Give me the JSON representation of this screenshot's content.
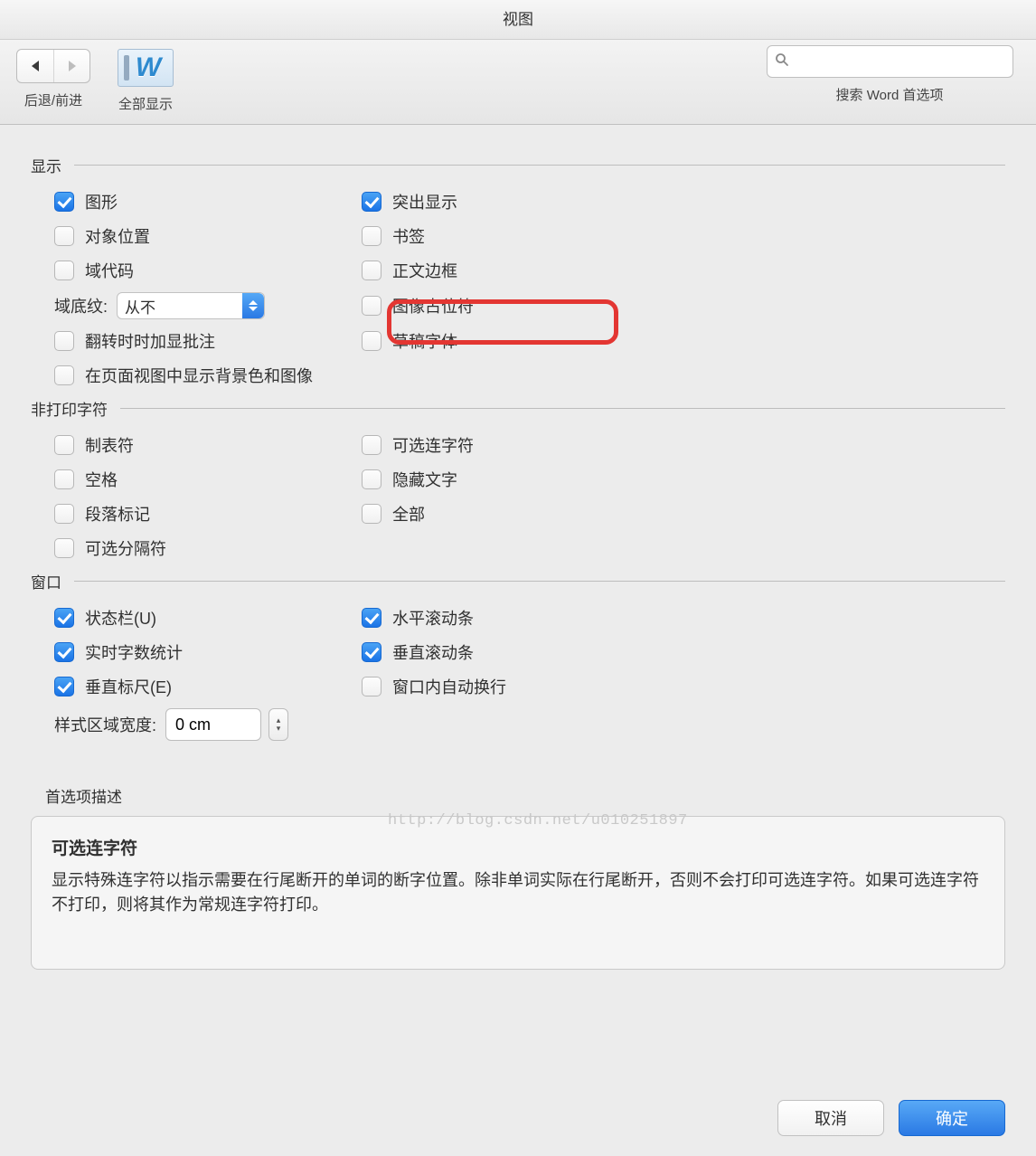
{
  "window": {
    "title": "视图"
  },
  "toolbar": {
    "nav_label": "后退/前进",
    "show_all_label": "全部显示",
    "search_label": "搜索 Word 首选项",
    "search_placeholder": ""
  },
  "sections": {
    "display": {
      "title": "显示",
      "left": [
        {
          "label": "图形",
          "checked": true
        },
        {
          "label": "对象位置",
          "checked": false
        },
        {
          "label": "域代码",
          "checked": false
        }
      ],
      "field_shading_label": "域底纹:",
      "field_shading_value": "从不",
      "left2": [
        {
          "label": "翻转时时加显批注",
          "checked": false
        },
        {
          "label": "在页面视图中显示背景色和图像",
          "checked": false
        }
      ],
      "right": [
        {
          "label": "突出显示",
          "checked": true
        },
        {
          "label": "书签",
          "checked": false
        },
        {
          "label": "正文边框",
          "checked": false
        },
        {
          "label": "图像占位符",
          "checked": false
        },
        {
          "label": "草稿字体",
          "checked": false
        }
      ]
    },
    "nonprint": {
      "title": "非打印字符",
      "left": [
        {
          "label": "制表符",
          "checked": false
        },
        {
          "label": "空格",
          "checked": false
        },
        {
          "label": "段落标记",
          "checked": false
        },
        {
          "label": "可选分隔符",
          "checked": false
        }
      ],
      "right": [
        {
          "label": "可选连字符",
          "checked": false
        },
        {
          "label": "隐藏文字",
          "checked": false
        },
        {
          "label": "全部",
          "checked": false
        }
      ]
    },
    "window": {
      "title": "窗口",
      "left": [
        {
          "label": "状态栏(U)",
          "checked": true
        },
        {
          "label": "实时字数统计",
          "checked": true
        },
        {
          "label": "垂直标尺(E)",
          "checked": true
        }
      ],
      "right": [
        {
          "label": "水平滚动条",
          "checked": true
        },
        {
          "label": "垂直滚动条",
          "checked": true
        },
        {
          "label": "窗口内自动换行",
          "checked": false
        }
      ],
      "style_width_label": "样式区域宽度:",
      "style_width_value": "0 cm"
    }
  },
  "watermark": "http://blog.csdn.net/u010251897",
  "description": {
    "header": "首选项描述",
    "title": "可选连字符",
    "body": "显示特殊连字符以指示需要在行尾断开的单词的断字位置。除非单词实际在行尾断开，否则不会打印可选连字符。如果可选连字符不打印，则将其作为常规连字符打印。"
  },
  "buttons": {
    "cancel": "取消",
    "ok": "确定"
  }
}
